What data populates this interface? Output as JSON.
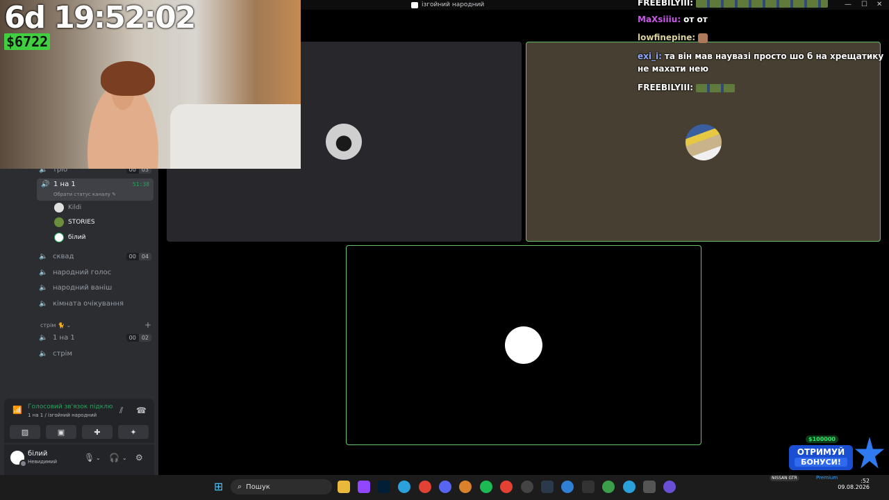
{
  "window": {
    "title": "ізгойний народний",
    "minimize": "—",
    "maximize": "☐",
    "close": "✕"
  },
  "overlay": {
    "timer": "6d 19:52:02",
    "money": "$6722"
  },
  "chat": {
    "messages": [
      {
        "user": "FREEBILYIII:",
        "text": "",
        "user_color": "#ffffff",
        "emotes": "long"
      },
      {
        "user": "MaXsiiiu:",
        "text": "от от",
        "user_color": "#c957e8"
      },
      {
        "user": "lowfinepine:",
        "text": "",
        "user_color": "#d8d29a",
        "emotes": "face"
      },
      {
        "user": "exi_i:",
        "text": "та він мав наувазі просто шо б на хрещатику",
        "text2": "не махати нею",
        "user_color": "#8fa9ff"
      },
      {
        "user": "FREEBILYIII:",
        "text": "",
        "user_color": "#ffffff",
        "emotes": "short"
      }
    ]
  },
  "sidebar": {
    "partial_channel": {
      "label": "тріо",
      "count_a": "00",
      "count_b": "03"
    },
    "active_channel": {
      "label": "1 на 1",
      "timer": "51:38",
      "status": "Обрати статус каналу ✎"
    },
    "members": [
      {
        "name": "Kildi",
        "avatar_color": "#e0e0e0"
      },
      {
        "name": "STORIES",
        "avatar_color": "#6a8f3a"
      },
      {
        "name": "білий",
        "avatar_color": "#ffffff"
      }
    ],
    "channels": [
      {
        "label": "сквад",
        "count_a": "00",
        "count_b": "04"
      },
      {
        "label": "народний голос"
      },
      {
        "label": "народний ваніш"
      },
      {
        "label": "кімната очікування"
      }
    ],
    "category": {
      "label": "стрім 🐈 ⌄",
      "plus": "+"
    },
    "stream_channels": [
      {
        "label": "1 на 1",
        "count_a": "00",
        "count_b": "02"
      },
      {
        "label": "стрім"
      }
    ]
  },
  "voice_panel": {
    "status": "Голосовий зв'язок підклю",
    "sub": "1 на 1 / ізгойний народний"
  },
  "user": {
    "name": "білий",
    "status": "Невидимий"
  },
  "ad": {
    "amount": "$100000",
    "line1": "ОТРИМУЙ",
    "line2": "БОНУСИ!"
  },
  "taskbar": {
    "search_placeholder": "Пошук",
    "tray_car": "NISSAN GTR",
    "tray_premium": "Premium",
    "time": ":52",
    "date": "09.08.2026"
  },
  "colors": {
    "accent_green": "#23a55a",
    "tile_border": "#6ac46f",
    "discord_bg": "#2b2d31"
  }
}
